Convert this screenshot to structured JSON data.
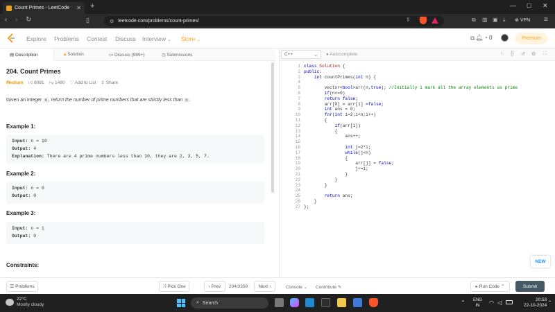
{
  "browser": {
    "tab_title": "Count Primes - LeetCode",
    "url": "leetcode.com/problems/count-primes/",
    "vpn_label": "VPN",
    "ext_badge": "5"
  },
  "lcnav": {
    "links": [
      "Explore",
      "Problems",
      "Contest",
      "Discuss",
      "Interview",
      "Store"
    ],
    "coins": "0",
    "premium": "Premium"
  },
  "left": {
    "tabs": [
      "Description",
      "Solution",
      "Discuss (999+)",
      "Submissions"
    ],
    "title": "204. Count Primes",
    "difficulty": "Medium",
    "likes": "8081",
    "dislikes": "1480",
    "add_to_list": "Add to List",
    "share": "Share",
    "statement_a": "Given an integer ",
    "statement_n": "n",
    "statement_b": ", return the number of prime numbers that are strictly less than ",
    "statement_c": ".",
    "examples": [
      {
        "heading": "Example 1:",
        "input_label": "Input:",
        "input": "n = 10",
        "output_label": "Output:",
        "output": "4",
        "explanation_label": "Explanation:",
        "explanation": "There are 4 prime numbers less than 10, they are 2, 3, 5, 7."
      },
      {
        "heading": "Example 2:",
        "input_label": "Input:",
        "input": "n = 0",
        "output_label": "Output:",
        "output": "0"
      },
      {
        "heading": "Example 3:",
        "input_label": "Input:",
        "input": "n = 1",
        "output_label": "Output:",
        "output": "0"
      }
    ],
    "constraints": "Constraints:"
  },
  "editor": {
    "language": "C++",
    "autocomplete": "Autocomplete",
    "line_count": 27
  },
  "footer": {
    "problems": "Problems",
    "pick_one": "Pick One",
    "prev": "Prev",
    "counter": "204/3358",
    "next": "Next",
    "console": "Console",
    "contribute": "Contribute",
    "run_code": "Run Code",
    "submit": "Submit",
    "new_badge": "NEW"
  },
  "taskbar": {
    "weather_temp": "22°C",
    "weather_text": "Mostly cloudy",
    "search": "Search",
    "lang_top": "ENG",
    "lang_bottom": "IN",
    "time": "20:53",
    "date": "22-10-2024"
  }
}
